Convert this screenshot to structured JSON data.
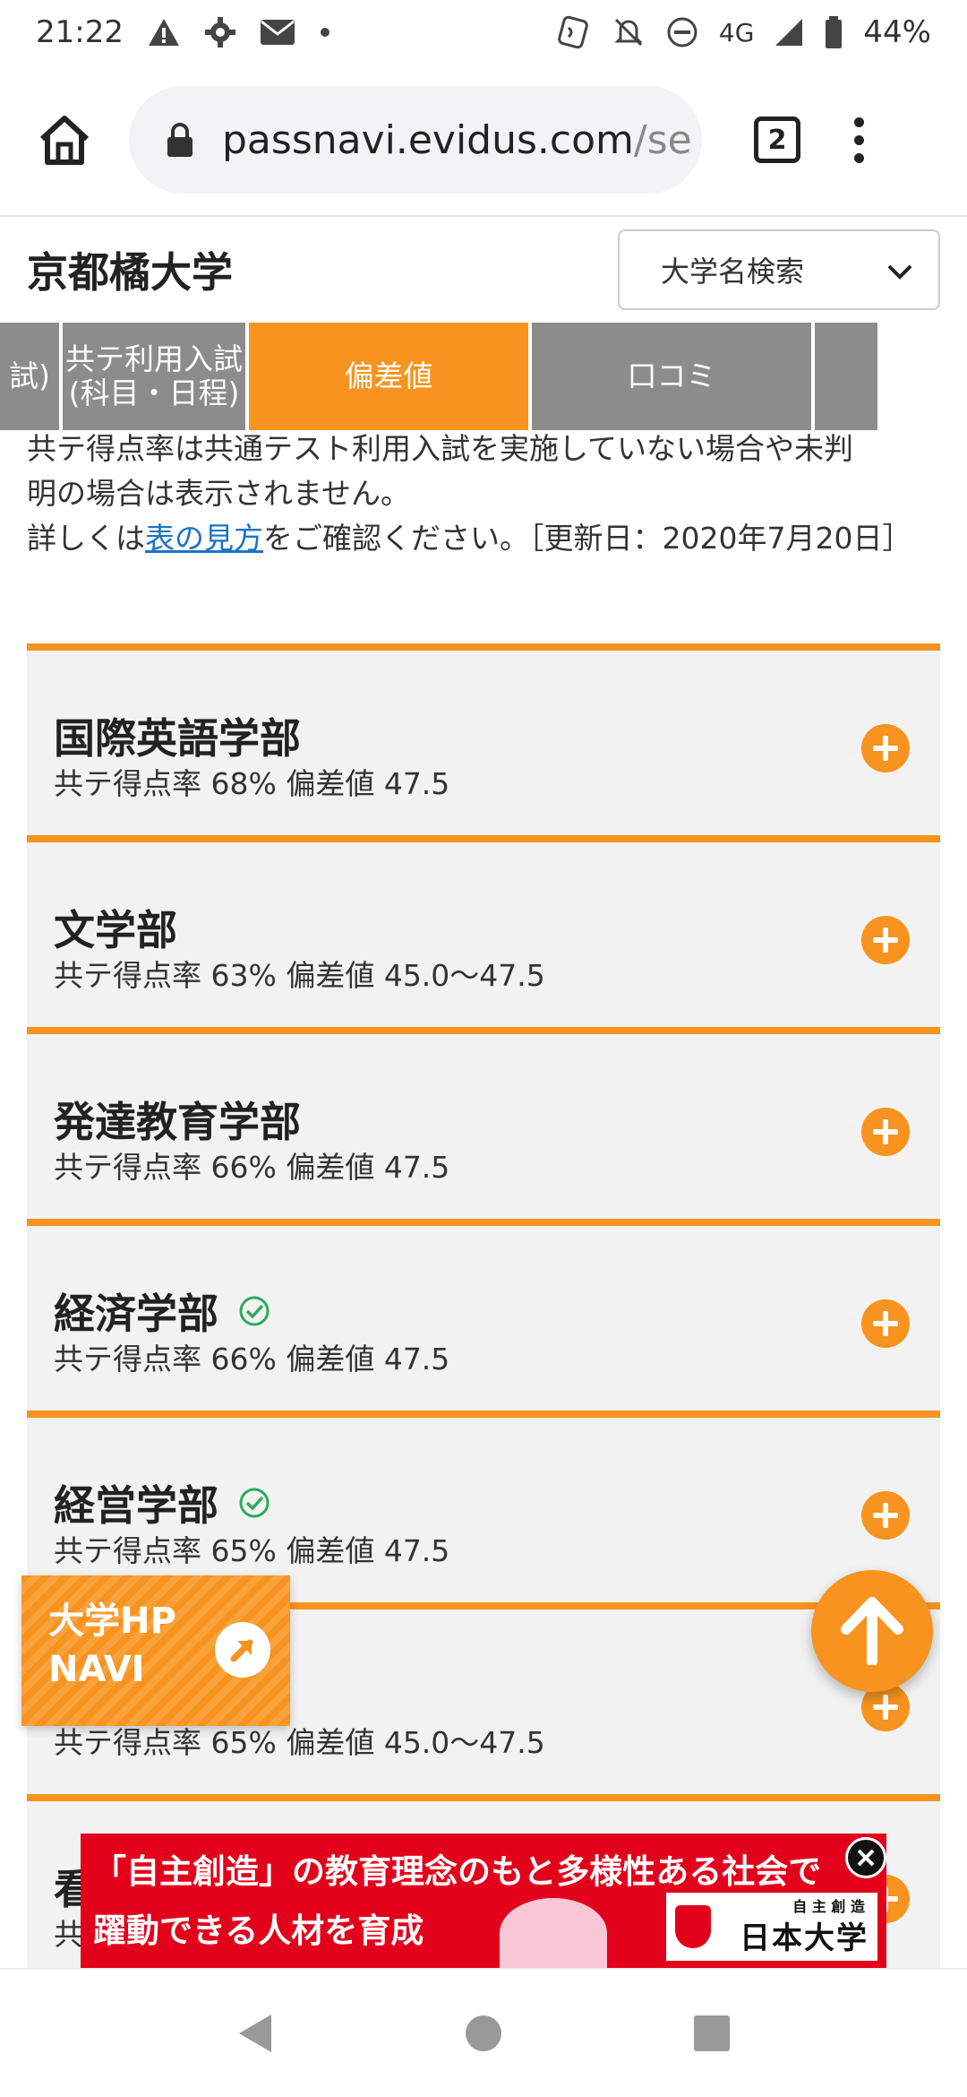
{
  "status_bar": {
    "time": "21:22",
    "network": "4G",
    "battery": "44%"
  },
  "browser": {
    "url_host": "passnavi.evidus.com",
    "url_path": "/se",
    "tab_count": "2"
  },
  "header": {
    "title": "京都橘大学",
    "search_label": "大学名検索"
  },
  "tabs": [
    {
      "label": "試)"
    },
    {
      "label": "共テ利用入試\n(科目・日程)"
    },
    {
      "label": "偏差値"
    },
    {
      "label": "口コミ"
    },
    {
      "label": ""
    }
  ],
  "notice": {
    "line1": "共テ得点率は共通テスト利用入試を実施していない場合や未判",
    "line2": "明の場合は表示されません。",
    "prefix": "詳しくは",
    "link": "表の見方",
    "suffix": "をご確認ください。［更新日：2020年7月20日］"
  },
  "faculties": [
    {
      "name": "国際英語学部",
      "stats": "共テ得点率 68% 偏差値 47.5",
      "checked": false
    },
    {
      "name": "文学部",
      "stats": "共テ得点率 63% 偏差値 45.0～47.5",
      "checked": false
    },
    {
      "name": "発達教育学部",
      "stats": "共テ得点率 66% 偏差値 47.5",
      "checked": false
    },
    {
      "name": "経済学部",
      "stats": "共テ得点率 66% 偏差値 47.5",
      "checked": true
    },
    {
      "name": "経営学部",
      "stats": "共テ得点率 65% 偏差値 47.5",
      "checked": true
    },
    {
      "name": "",
      "stats": "共テ得点率 65% 偏差値 45.0～47.5",
      "checked": false
    },
    {
      "name": "看",
      "stats": "共",
      "checked": false
    }
  ],
  "hp_navi": {
    "line1": "大学HP",
    "line2": "NAVI"
  },
  "ad": {
    "line1": "「自主創造」の教育理念のもと多様性ある社会で",
    "line2": "躍動できる人材を育成",
    "logo_small": "自 主 創 造",
    "logo_big": "日本大学"
  },
  "colors": {
    "accent": "#f7931e",
    "tab_inactive": "#8c8c8c",
    "ad_red": "#e3001b",
    "check_green": "#2eaa5c"
  }
}
